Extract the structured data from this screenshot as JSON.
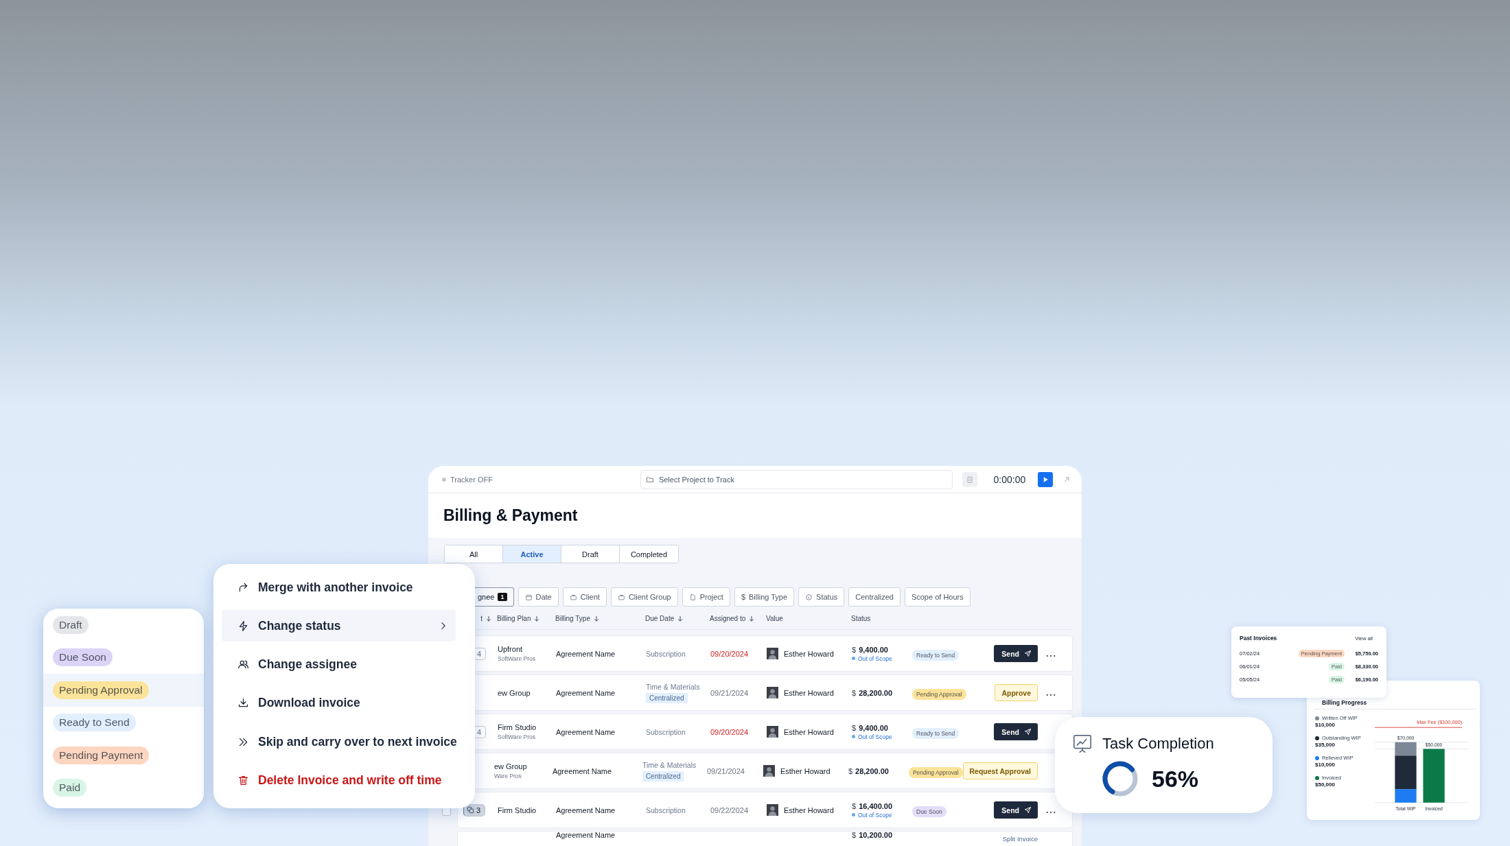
{
  "billing_window": {
    "tracker": {
      "label": "Tracker OFF",
      "on": false
    },
    "project_search": {
      "placeholder": "Select Project to Track"
    },
    "timer": "0:00:00",
    "title": "Billing & Payment",
    "tabs": [
      {
        "label": "All",
        "selected": false
      },
      {
        "label": "Active",
        "selected": true
      },
      {
        "label": "Draft",
        "selected": false
      },
      {
        "label": "Completed",
        "selected": false
      }
    ],
    "filters": [
      {
        "label": "gnee",
        "count": "1"
      },
      {
        "label": "Date",
        "kind": "calendar"
      },
      {
        "label": "Client",
        "kind": "briefcase"
      },
      {
        "label": "Client Group",
        "kind": "briefcase"
      },
      {
        "label": "Project",
        "kind": "file"
      },
      {
        "label": "Billing Type",
        "glyph": "$"
      },
      {
        "label": "Status",
        "kind": "info"
      },
      {
        "label": "Centralized"
      },
      {
        "label": "Scope of Hours"
      }
    ],
    "columns": [
      {
        "label": "t",
        "sortable": true
      },
      {
        "label": "Billing Plan",
        "sortable": true
      },
      {
        "label": "Billing Type",
        "sortable": true
      },
      {
        "label": "Due Date",
        "sortable": true
      },
      {
        "label": "Assigned to",
        "sortable": true
      },
      {
        "label": "Value",
        "sortable": false
      },
      {
        "label": "Status",
        "sortable": false
      }
    ],
    "rows": [
      {
        "count": "4",
        "name": "Upfront",
        "client": "SoftWare Pros",
        "plan": "Agreement Name",
        "billing_type": "Subscription",
        "due": "09/20/2024",
        "overdue": true,
        "assignee": "Esther Howard",
        "currency": "$",
        "value": "9,400.00",
        "scope": "Out of Scope",
        "status": {
          "label": "Ready to Send",
          "color": "#e2effd"
        },
        "action": {
          "kind": "send",
          "label": "Send"
        },
        "more": true
      },
      {
        "name": "ew Group",
        "plan": "Agreement Name",
        "billing_type": "Time & Materials",
        "tag": "Centralized",
        "due": "09/21/2024",
        "overdue": false,
        "assignee": "Esther Howard",
        "currency": "$",
        "value": "28,200.00",
        "status": {
          "label": "Pending Approval",
          "color": "#fbe39a"
        },
        "action": {
          "kind": "approve",
          "label": "Approve"
        },
        "more": true
      },
      {
        "count": "4",
        "name": "Firm Studio",
        "client": "SoftWare Pros",
        "plan": "Agreement Name",
        "billing_type": "Subscription",
        "due": "09/20/2024",
        "overdue": true,
        "assignee": "Esther Howard",
        "currency": "$",
        "value": "9,400.00",
        "scope": "Out of Scope",
        "status": {
          "label": "Ready to Send",
          "color": "#e2effd"
        },
        "action": {
          "kind": "send",
          "label": "Send"
        },
        "more": false
      },
      {
        "name": "ew Group",
        "client": "Ware Pros",
        "plan": "Agreement Name",
        "billing_type": "Time & Materials",
        "tag": "Centralized",
        "due": "09/21/2024",
        "overdue": false,
        "assignee": "Esther Howard",
        "currency": "$",
        "value": "28,200.00",
        "status": {
          "label": "Pending Approval",
          "color": "#fbe39a"
        },
        "action": {
          "kind": "approve",
          "label": "Request Approval"
        },
        "more": false
      },
      {
        "checked": false,
        "count": "3",
        "name": "Firm Studio",
        "plan": "Agreement Name",
        "billing_type": "Subscription",
        "due": "09/22/2024",
        "overdue": false,
        "assignee": "Esther Howard",
        "currency": "$",
        "value": "16,400.00",
        "scope": "Out of Scope",
        "status": {
          "label": "Due Soon",
          "color": "#e4ddf8"
        },
        "action": {
          "kind": "send",
          "label": "Send"
        },
        "more": true
      },
      {
        "partial": true,
        "plan": "Agreement Name",
        "currency": "$",
        "value": "10,200.00",
        "action": {
          "kind": "link",
          "label": "Split Invoice"
        },
        "more": false
      }
    ]
  },
  "status_menu": [
    {
      "label": "Draft",
      "color": "#e4e6ea",
      "selected": false
    },
    {
      "label": "Due Soon",
      "color": "#dcd4f6",
      "selected": false
    },
    {
      "label": "Pending Approval",
      "color": "#fbe39a",
      "selected": true
    },
    {
      "label": "Ready to Send",
      "color": "#e2effd",
      "selected": false
    },
    {
      "label": "Pending Payment",
      "color": "#fcd6c0",
      "selected": false
    },
    {
      "label": "Paid",
      "color": "#d8f5e5",
      "selected": false
    }
  ],
  "context_menu": [
    {
      "label": "Merge with another invoice",
      "kind": "merge",
      "selected": false
    },
    {
      "label": "Change status",
      "kind": "status",
      "selected": true,
      "submenu": true
    },
    {
      "label": "Change assignee",
      "kind": "assignee",
      "selected": false
    },
    {
      "label": "Download invoice",
      "kind": "download",
      "selected": false
    },
    {
      "label": "Skip and carry over to next invoice",
      "kind": "skip",
      "selected": false
    },
    {
      "label": "Delete Invoice and write off time",
      "kind": "delete",
      "selected": false,
      "danger": true
    }
  ],
  "task_completion": {
    "title": "Task Completion",
    "level": 0.56,
    "reading": "56%"
  },
  "past_invoices": {
    "title": "Past Invoices",
    "link": "View all",
    "rows": [
      {
        "date": "07/02/24",
        "status": {
          "label": "Pending Payment",
          "color": "#fcd6c0"
        },
        "amount": "$5,750.00"
      },
      {
        "date": "06/01/24",
        "status": {
          "label": "Paid",
          "color": "#d8f5e5"
        },
        "amount": "$8,330.00"
      },
      {
        "date": "05/05/24",
        "status": {
          "label": "Paid",
          "color": "#d8f5e5"
        },
        "amount": "$6,190.00"
      }
    ]
  },
  "billing_progress": {
    "title": "Billing Progress",
    "legend": [
      {
        "name": "Written Off WIP",
        "amount": "$10,000",
        "color": "#7c8798"
      },
      {
        "name": "Outstanding WIP",
        "amount": "$35,000",
        "color": "#1f2a3a"
      },
      {
        "name": "Relieved WIP",
        "amount": "$10,000",
        "color": "#1d7cf2"
      },
      {
        "name": "Invoiced",
        "amount": "$50,000",
        "color": "#0b7a48"
      }
    ],
    "chart": {
      "max_fee": "Max Fee ($100,000)",
      "bars": [
        {
          "category": "Total WIP",
          "value_label": "$70,000"
        },
        {
          "category": "Invoiced",
          "value_label": "$50,000"
        }
      ]
    }
  }
}
